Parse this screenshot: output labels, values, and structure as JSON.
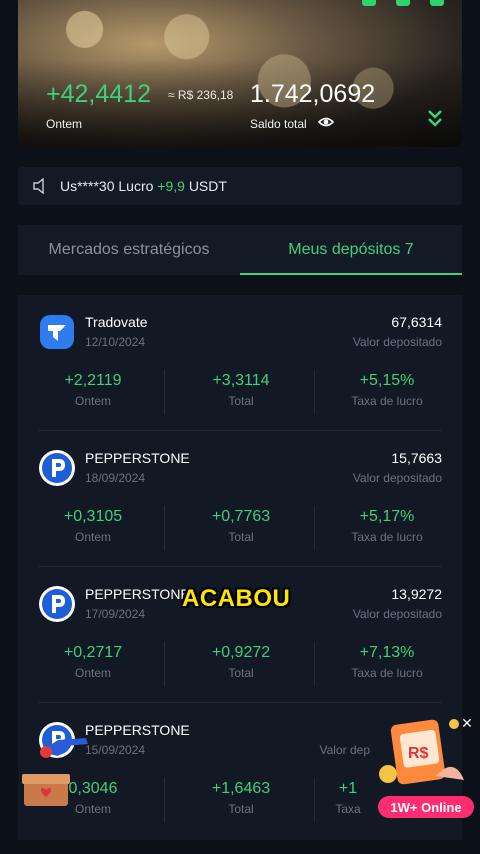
{
  "hero": {
    "gain": "+42,4412",
    "gain_brl": "≈ R$ 236,18",
    "gain_label": "Ontem",
    "total": "1.742,0692",
    "total_label": "Saldo total"
  },
  "ticker": {
    "prefix": "Us****30 Lucro",
    "value": "+9,9",
    "suffix": "USDT"
  },
  "tabs": [
    {
      "label": "Mercados estratégicos"
    },
    {
      "label": "Meus depósitos  7"
    }
  ],
  "deposits": [
    {
      "name": "Tradovate",
      "date": "12/10/2024",
      "amount": "67,6314",
      "amount_label": "Valor depositado",
      "yesterday": "+2,2119",
      "yesterday_label": "Ontem",
      "total": "+3,3114",
      "total_label": "Total",
      "rate": "+5,15%",
      "rate_label": "Taxa de lucro"
    },
    {
      "name": "PEPPERSTONE",
      "date": "18/09/2024",
      "amount": "15,7663",
      "amount_label": "Valor depositado",
      "yesterday": "+0,3105",
      "yesterday_label": "Ontem",
      "total": "+0,7763",
      "total_label": "Total",
      "rate": "+5,17%",
      "rate_label": "Taxa de lucro"
    },
    {
      "name": "PEPPERSTONE",
      "date": "17/09/2024",
      "amount": "13,9272",
      "amount_label": "Valor depositado",
      "yesterday": "+0,2717",
      "yesterday_label": "Ontem",
      "total": "+0,9272",
      "total_label": "Total",
      "rate": "+7,13%",
      "rate_label": "Taxa de lucro"
    },
    {
      "name": "PEPPERSTONE",
      "date": "15/09/2024",
      "amount": "",
      "amount_label": "Valor dep",
      "yesterday": "0,3046",
      "yesterday_label": "Ontem",
      "total": "+1,6463",
      "total_label": "Total",
      "rate": "+1",
      "rate_label": "Taxa"
    }
  ],
  "overlay_text": "ACABOU",
  "promo": {
    "badge": "1W+ Online",
    "coin_text": "R$"
  },
  "colors": {
    "accent": "#3fd07a",
    "background": "#0c1018",
    "card": "#121824",
    "promo": "#ff2d6f"
  }
}
